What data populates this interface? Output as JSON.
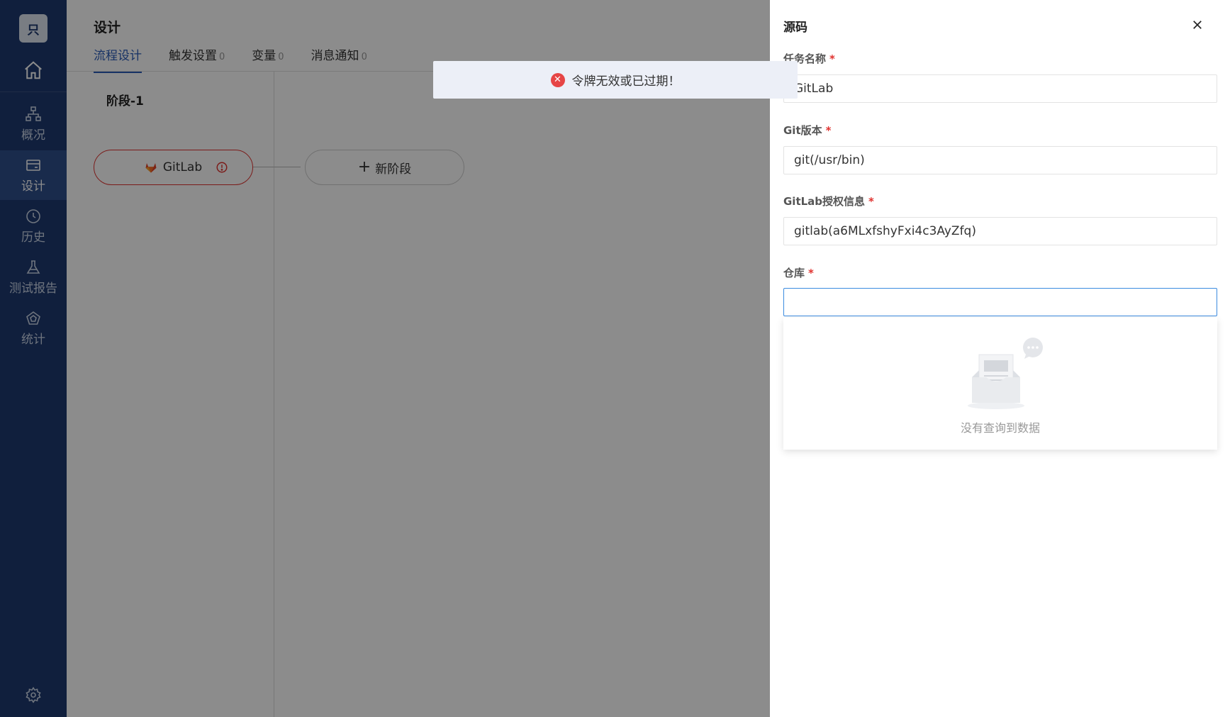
{
  "sidebar": {
    "logo_text": "只",
    "items": [
      {
        "label": "概况",
        "icon": "hierarchy-icon"
      },
      {
        "label": "设计",
        "icon": "card-icon"
      },
      {
        "label": "历史",
        "icon": "clock-icon"
      },
      {
        "label": "测试报告",
        "icon": "flask-icon"
      },
      {
        "label": "统计",
        "icon": "pentagon-icon"
      }
    ],
    "active_index": 1
  },
  "header": {
    "title": "设计",
    "tabs": [
      {
        "label": "流程设计",
        "count": ""
      },
      {
        "label": "触发设置",
        "count": "0"
      },
      {
        "label": "变量",
        "count": "0"
      },
      {
        "label": "消息通知",
        "count": "0"
      }
    ]
  },
  "pipeline": {
    "stage_title": "阶段-1",
    "task_label": "GitLab",
    "new_stage_label": "新阶段"
  },
  "toast": {
    "message": "令牌无效或已过期！",
    "type": "error",
    "color": "#e64545"
  },
  "drawer": {
    "title": "源码",
    "fields": {
      "task_name": {
        "label": "任务名称",
        "value": "GitLab"
      },
      "git_version": {
        "label": "Git版本",
        "value": "git(/usr/bin)"
      },
      "auth": {
        "label": "GitLab授权信息",
        "value": "gitlab(a6MLxfshyFxi4c3AyZfq)"
      },
      "repo": {
        "label": "仓库",
        "value": ""
      }
    },
    "empty_text": "没有查询到数据"
  },
  "colors": {
    "sidebar_bg": "#1e3a6f",
    "accent": "#2a5bb8",
    "error": "#e0322f",
    "focus": "#3b8be0"
  }
}
